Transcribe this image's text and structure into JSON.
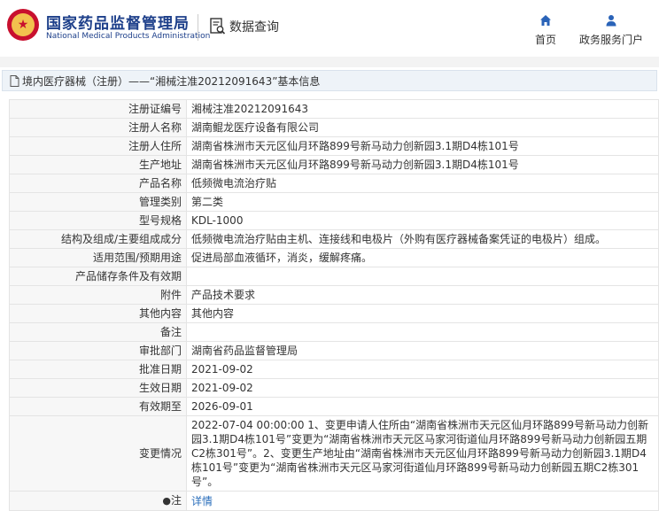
{
  "header": {
    "org_name": "国家药品监督管理局",
    "org_name_en": "National Medical Products Administration",
    "query_label": "数据查询",
    "nav": {
      "home_label": "首页",
      "service_label": "政务服务门户"
    }
  },
  "breadcrumb": {
    "text": "境内医疗器械（注册）——“湘械注准20212091643”基本信息"
  },
  "record": {
    "rows": [
      {
        "k": "注册证编号",
        "v": "湘械注准20212091643"
      },
      {
        "k": "注册人名称",
        "v": "湖南鲲龙医疗设备有限公司"
      },
      {
        "k": "注册人住所",
        "v": "湖南省株洲市天元区仙月环路899号新马动力创新园3.1期D4栋101号"
      },
      {
        "k": "生产地址",
        "v": "湖南省株洲市天元区仙月环路899号新马动力创新园3.1期D4栋101号"
      },
      {
        "k": "产品名称",
        "v": "低频微电流治疗贴"
      },
      {
        "k": "管理类别",
        "v": "第二类"
      },
      {
        "k": "型号规格",
        "v": "KDL-1000"
      },
      {
        "k": "结构及组成/主要组成成分",
        "v": "低频微电流治疗贴由主机、连接线和电极片（外购有医疗器械备案凭证的电极片）组成。"
      },
      {
        "k": "适用范围/预期用途",
        "v": "促进局部血液循环，消炎，缓解疼痛。"
      },
      {
        "k": "产品储存条件及有效期",
        "v": ""
      },
      {
        "k": "附件",
        "v": "产品技术要求"
      },
      {
        "k": "其他内容",
        "v": "其他内容"
      },
      {
        "k": "备注",
        "v": ""
      },
      {
        "k": "审批部门",
        "v": "湖南省药品监督管理局"
      },
      {
        "k": "批准日期",
        "v": "2021-09-02"
      },
      {
        "k": "生效日期",
        "v": "2021-09-02"
      },
      {
        "k": "有效期至",
        "v": "2026-09-01"
      },
      {
        "k": "变更情况",
        "v": "2022-07-04 00:00:00 1、变更申请人住所由“湖南省株洲市天元区仙月环路899号新马动力创新园3.1期D4栋101号”变更为“湖南省株洲市天元区马家河街道仙月环路899号新马动力创新园五期C2栋301号”。2、变更生产地址由“湖南省株洲市天元区仙月环路899号新马动力创新园3.1期D4栋101号”变更为“湖南省株洲市天元区马家河街道仙月环路899号新马动力创新园五期C2栋301号”。"
      }
    ],
    "note_label": "注",
    "note_link": "详情"
  }
}
